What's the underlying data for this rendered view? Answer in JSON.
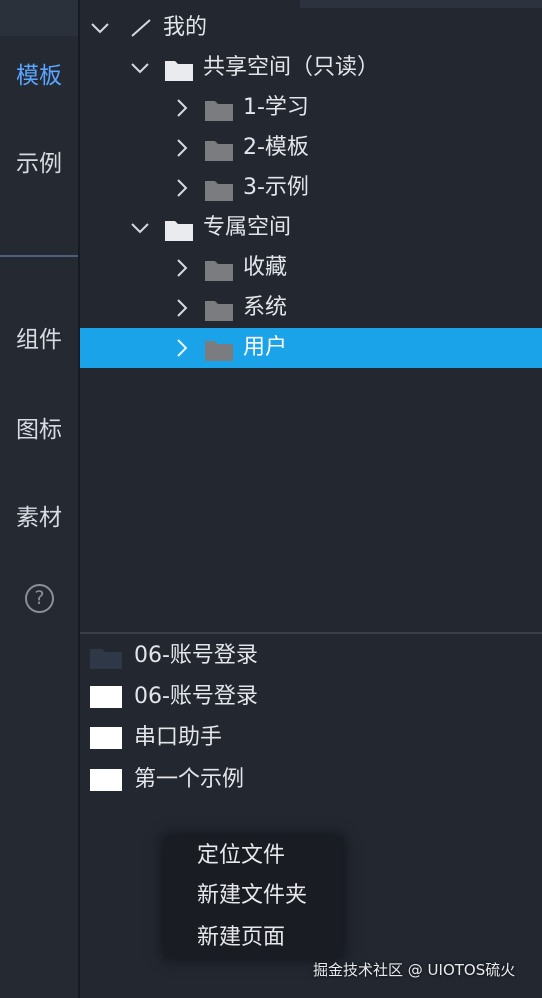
{
  "sidebar": {
    "items": [
      {
        "label": "模板",
        "active": true
      },
      {
        "label": "示例",
        "active": false
      },
      {
        "label": "组件",
        "active": false
      },
      {
        "label": "图标",
        "active": false
      },
      {
        "label": "素材",
        "active": false
      }
    ],
    "help_icon": "question-circle-icon",
    "help_glyph": "?",
    "active_color": "#5aa5ff"
  },
  "tree": {
    "root": {
      "label": "我的",
      "icon": "slash-icon",
      "expanded": true
    },
    "shared": {
      "label": "共享空间（只读）",
      "icon": "folder-open-icon",
      "expanded": true
    },
    "shared_children": [
      {
        "label": "1-学习"
      },
      {
        "label": "2-模板"
      },
      {
        "label": "3-示例"
      }
    ],
    "private": {
      "label": "专属空间",
      "icon": "folder-open-icon",
      "expanded": true
    },
    "private_children": [
      {
        "label": "收藏",
        "selected": false
      },
      {
        "label": "系统",
        "selected": false
      },
      {
        "label": "用户",
        "selected": true
      }
    ],
    "selection_color": "#1aa3e8"
  },
  "files": [
    {
      "label": "06-账号登录",
      "thumb": "dark-folder"
    },
    {
      "label": "06-账号登录",
      "thumb": "white"
    },
    {
      "label": "串口助手",
      "thumb": "white"
    },
    {
      "label": "第一个示例",
      "thumb": "white"
    }
  ],
  "context_menu": {
    "items": [
      "定位文件",
      "新建文件夹",
      "新建页面"
    ]
  },
  "watermark": "掘金技术社区 @ UIOTOS硫火"
}
